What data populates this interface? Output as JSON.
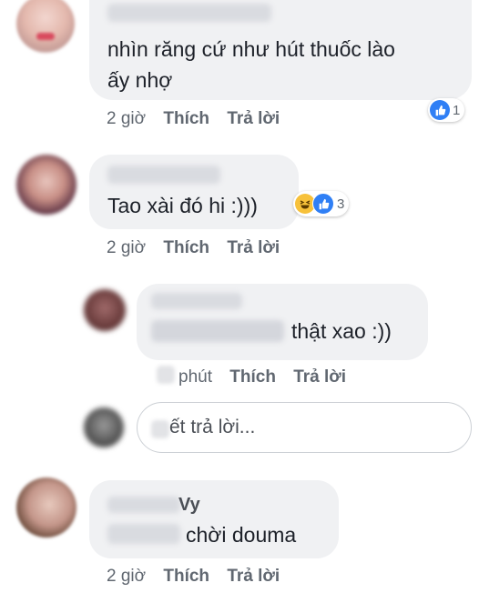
{
  "comments": [
    {
      "text_lines": [
        "nhìn răng cứ như hút thuốc lào",
        "ấy nhợ"
      ],
      "time": "2 giờ",
      "like_label": "Thích",
      "reply_label": "Trả lời",
      "reaction_count": "1"
    },
    {
      "text_lines": [
        "Tao xài đó hi :)))"
      ],
      "time": "2 giờ",
      "like_label": "Thích",
      "reply_label": "Trả lời",
      "reaction_count": "3"
    }
  ],
  "reply": {
    "text": "thật xao :))",
    "time": "phút",
    "like_label": "Thích",
    "reply_label": "Trả lời"
  },
  "reply_input": {
    "placeholder": "ết trả lời..."
  },
  "comment3": {
    "name_suffix": "Vy",
    "text": "chời douma",
    "time": "2 giờ",
    "like_label": "Thích",
    "reply_label": "Trả lời"
  },
  "colors": {
    "bubble": "#f0f1f3",
    "like_blue": "#2f7ff5",
    "haha_yellow": "#f7c13a",
    "meta_gray": "#606770"
  },
  "icons": [
    "like-icon",
    "haha-icon"
  ]
}
